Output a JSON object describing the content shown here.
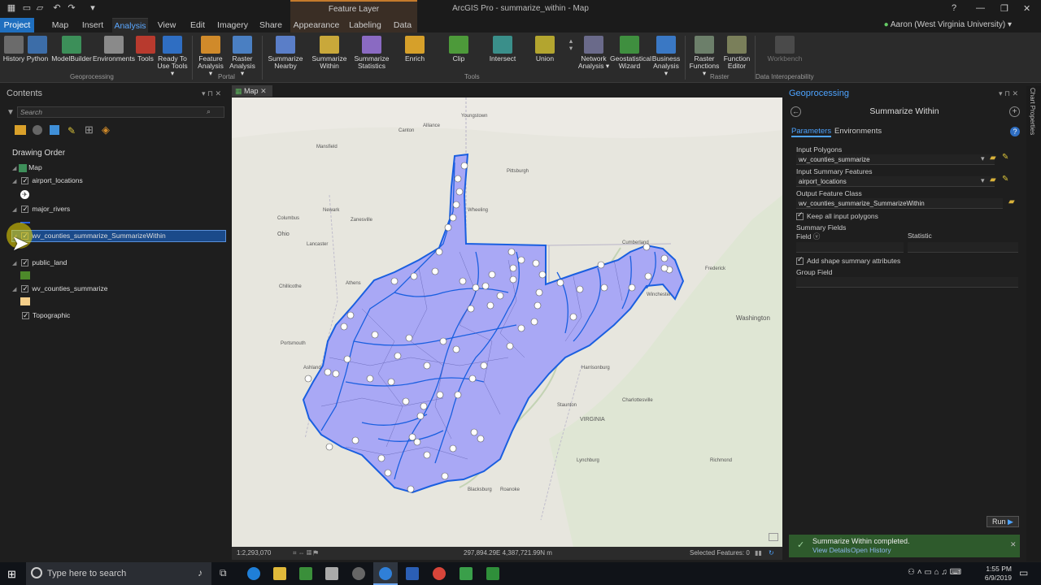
{
  "window": {
    "title": "ArcGIS Pro - summarize_within - Map",
    "context_tab_header": "Feature Layer",
    "user": "Aaron (West Virginia University)",
    "help": "?"
  },
  "menu_tabs": [
    "Project",
    "Map",
    "Insert",
    "Analysis",
    "View",
    "Edit",
    "Imagery",
    "Share",
    "Appearance",
    "Labeling",
    "Data"
  ],
  "ribbon": {
    "geoprocessing": [
      {
        "label": "History"
      },
      {
        "label": "Python"
      },
      {
        "label": "ModelBuilder"
      },
      {
        "label": "Environments"
      },
      {
        "label": "Tools"
      },
      {
        "label": "Ready To Use Tools"
      }
    ],
    "portal": [
      {
        "label": "Feature Analysis"
      },
      {
        "label": "Raster Analysis"
      }
    ],
    "tools": [
      {
        "label": "Summarize Nearby"
      },
      {
        "label": "Summarize Within"
      },
      {
        "label": "Summarize Statistics"
      },
      {
        "label": "Enrich"
      },
      {
        "label": "Clip"
      },
      {
        "label": "Intersect"
      },
      {
        "label": "Union"
      }
    ],
    "tools_more": [
      {
        "label": "Network Analysis"
      },
      {
        "label": "Geostatistical Wizard"
      },
      {
        "label": "Business Analysis"
      }
    ],
    "raster": [
      {
        "label": "Raster Functions"
      },
      {
        "label": "Function Editor"
      }
    ],
    "data_interop": [
      {
        "label": "Workbench"
      }
    ],
    "groups": [
      "Geoprocessing",
      "Portal",
      "Tools",
      "Raster",
      "Data Interoperability"
    ]
  },
  "contents": {
    "title": "Contents",
    "search_placeholder": "Search",
    "drawing_order": "Drawing Order",
    "map_label": "Map",
    "layers": [
      {
        "name": "airport_locations"
      },
      {
        "name": "major_rivers"
      },
      {
        "name": "wv_counties_summarize_SummarizeWithin"
      },
      {
        "name": "public_land"
      },
      {
        "name": "wv_counties_summarize"
      },
      {
        "name": "Topographic"
      }
    ]
  },
  "map": {
    "tab": "Map",
    "scale": "1:2,293,070",
    "coordinates": "297,894.29E 4,387,721.99N m",
    "selected_features": "Selected Features: 0",
    "place_labels": [
      "Youngstown",
      "Pittsburgh",
      "Alliance",
      "Canton",
      "Mansfield",
      "Newark",
      "Zanesville",
      "Columbus",
      "Lancaster",
      "Chillicothe",
      "Athens",
      "Portsmouth",
      "Ashland",
      "Frederick",
      "Washington",
      "Cumberland",
      "Winchester",
      "Harrisonburg",
      "Staunton",
      "Charlottesville",
      "Lynchburg",
      "Roanoke",
      "Blacksburg",
      "VIRGINIA",
      "Richmond",
      "Ohio",
      "Wheeling"
    ]
  },
  "geoprocessing": {
    "title": "Geoprocessing",
    "tool_title": "Summarize Within",
    "tabs": [
      "Parameters",
      "Environments"
    ],
    "input_polygons_label": "Input Polygons",
    "input_polygons": "wv_counties_summarize",
    "input_summary_label": "Input Summary Features",
    "input_summary": "airport_locations",
    "output_label": "Output Feature Class",
    "output": "wv_counties_summarize_SummarizeWithin",
    "keep_all": "Keep all input polygons",
    "summary_fields": "Summary Fields",
    "field_col": "Field",
    "statistic_col": "Statistic",
    "add_shape": "Add shape summary attributes",
    "group_field": "Group Field",
    "run": "Run",
    "message": "Summarize Within completed.",
    "view_details": "View Details",
    "open_history": "Open History",
    "side_label": "Chart Properties"
  },
  "taskbar": {
    "search_placeholder": "Type here to search",
    "time": "1:55 PM",
    "date": "6/9/2019"
  },
  "colors": {
    "accent": "#1f6fbf",
    "wv_fill": "#a9a8f5",
    "river": "#1a5fe0",
    "success": "#2e5a2c"
  }
}
